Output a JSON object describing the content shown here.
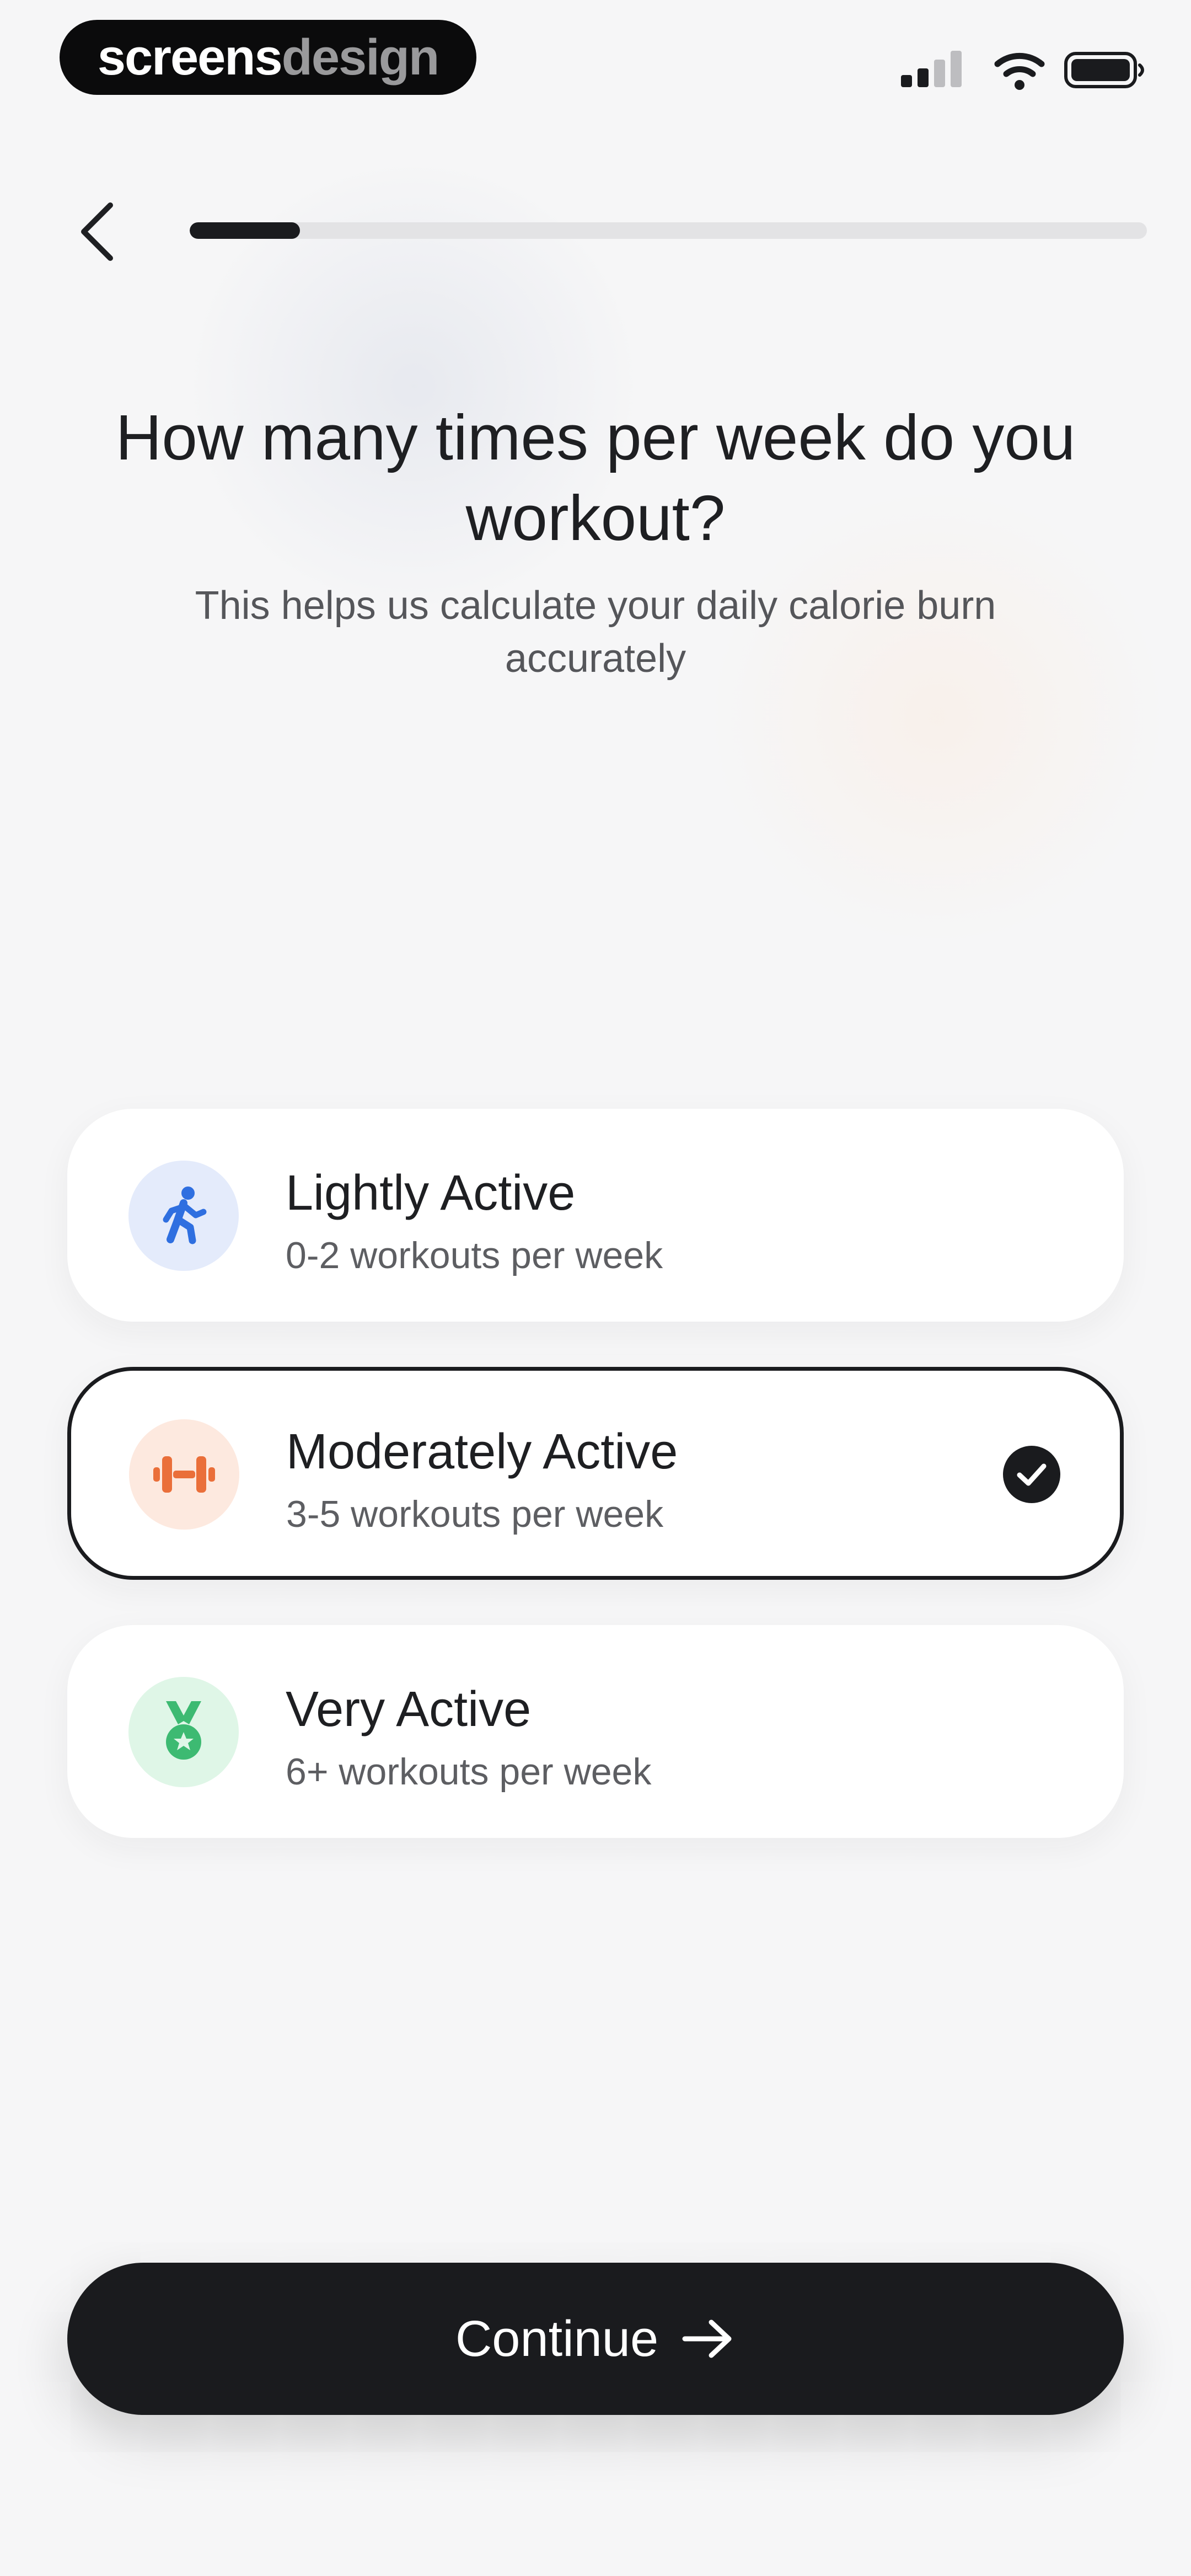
{
  "status_bar": {
    "brand_part1": "screens",
    "brand_part2": "design"
  },
  "nav": {
    "back_icon": "chevron-left-icon",
    "progress_fraction": 0.115
  },
  "header": {
    "title": "How many times per week do you workout?",
    "subtitle": "This helps us calculate your daily calorie burn accurately"
  },
  "options": [
    {
      "title": "Lightly Active",
      "subtitle": "0-2 workouts per week",
      "icon": "running-person-icon",
      "icon_color": "#2f6fe0",
      "icon_bg": "#e4ebfb",
      "selected": false
    },
    {
      "title": "Moderately Active",
      "subtitle": "3-5 workouts per week",
      "icon": "dumbbell-icon",
      "icon_color": "#ea6f3a",
      "icon_bg": "#fde9df",
      "selected": true
    },
    {
      "title": "Very Active",
      "subtitle": "6+ workouts per week",
      "icon": "medal-icon",
      "icon_color": "#3dba72",
      "icon_bg": "#dff6e7",
      "selected": false
    }
  ],
  "continue_button": {
    "label": "Continue",
    "icon": "arrow-right-icon"
  },
  "colors": {
    "accent": "#1a1b1e",
    "background": "#f6f6f7"
  }
}
